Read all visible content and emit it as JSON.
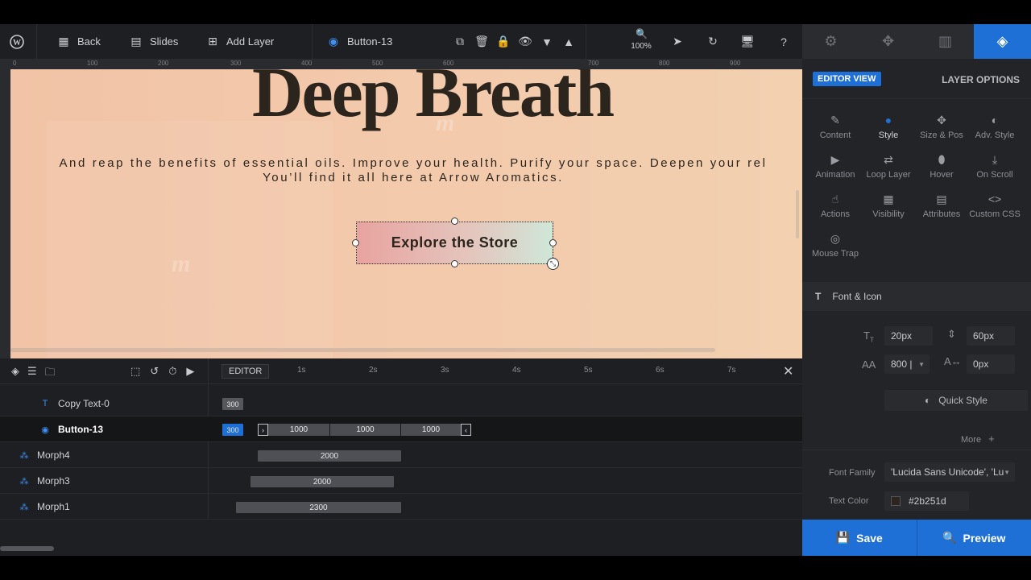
{
  "toolbar": {
    "back_label": "Back",
    "slides_label": "Slides",
    "add_layer_label": "Add Layer",
    "current_layer": "Button-13",
    "zoom": "100%"
  },
  "ruler": {
    "labels": [
      "0",
      "100",
      "200",
      "300",
      "400",
      "500",
      "600",
      "700",
      "800",
      "900"
    ]
  },
  "canvas": {
    "title": "Deep Breath",
    "subtitle_line1": "And reap the benefits of essential oils. Improve your health. Purify your space. Deepen your rel",
    "subtitle_line2": "You’ll find it all here at Arrow Aromatics.",
    "button_text": "Explore the Store",
    "watermark": "m"
  },
  "timeline": {
    "editor_tag": "EDITOR",
    "times": [
      "1s",
      "2s",
      "3s",
      "4s",
      "5s",
      "6s",
      "7s"
    ],
    "rows": [
      {
        "name": "Copy Text-0",
        "start": "300"
      },
      {
        "name": "Button-13",
        "start": "300",
        "seg1": "1000",
        "seg2": "1000",
        "seg3": "1000"
      },
      {
        "name": "Morph4",
        "duration": "2000"
      },
      {
        "name": "Morph3",
        "duration": "2000"
      },
      {
        "name": "Morph1",
        "duration": "2300"
      }
    ]
  },
  "side": {
    "editor_view": "EDITOR VIEW",
    "layer_options": "LAYER OPTIONS",
    "options": [
      "Content",
      "Style",
      "Size & Pos",
      "Adv. Style",
      "Animation",
      "Loop Layer",
      "Hover",
      "On Scroll",
      "Actions",
      "Visibility",
      "Attributes",
      "Custom CSS",
      "Mouse Trap"
    ],
    "section_title": "Font & Icon",
    "font_size": "20px",
    "line_height": "60px",
    "font_weight": "800 |",
    "letter_spacing": "0px",
    "quick_style": "Quick Style",
    "more": "More",
    "font_family_label": "Font Family",
    "font_family_value": "'Lucida Sans Unicode', 'Lu",
    "text_color_label": "Text Color",
    "text_color_value": "#2b251d"
  },
  "actions": {
    "save": "Save",
    "preview": "Preview"
  },
  "colors": {
    "accent": "#1e6fd6",
    "text_dark": "#2b251d"
  }
}
